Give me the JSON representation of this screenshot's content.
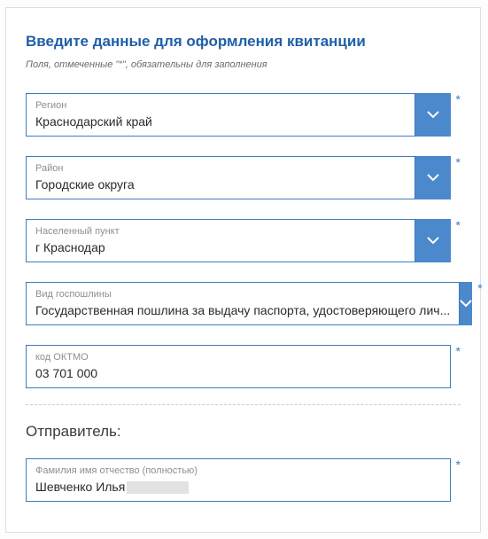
{
  "title": "Введите данные для оформления квитанции",
  "note_prefix": "Поля, отмеченные \"",
  "note_mark": "*",
  "note_suffix": "\", обязательны для заполнения",
  "fields": {
    "region": {
      "label": "Регион",
      "value": "Краснодарский край"
    },
    "district": {
      "label": "Район",
      "value": "Городские округа"
    },
    "locality": {
      "label": "Населенный пункт",
      "value": "г Краснодар"
    },
    "dutyType": {
      "label": "Вид госпошлины",
      "value": "Государственная пошлина за выдачу паспорта, удостоверяющего лич..."
    },
    "oktmo": {
      "label": "код ОКТМО",
      "value": "03 701 000"
    }
  },
  "sender_heading": "Отправитель:",
  "sender": {
    "label": "Фамилия имя отчество (полностью)",
    "value": "Шевченко Илья"
  },
  "required_mark": "*"
}
